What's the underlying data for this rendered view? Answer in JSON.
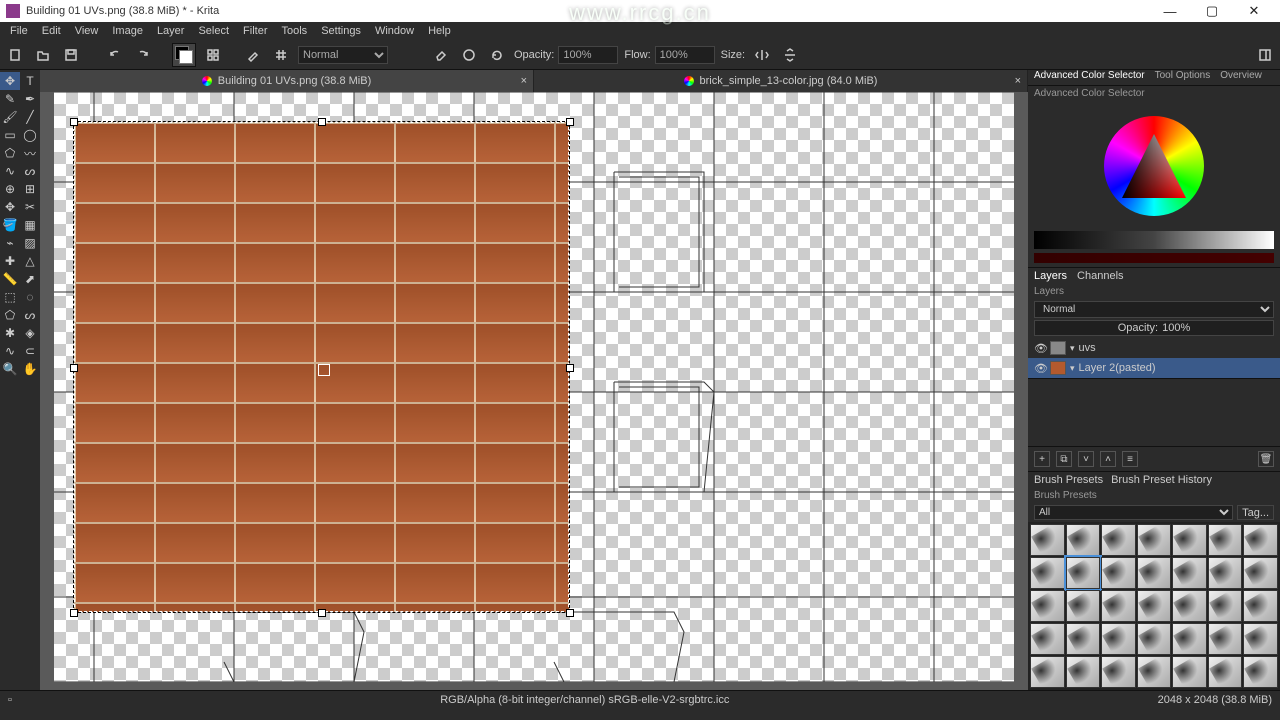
{
  "app": {
    "name": "Krita",
    "title": "Building 01 UVs.png (38.8 MiB) * - Krita"
  },
  "window_buttons": {
    "min": "—",
    "max": "▢",
    "close": "✕"
  },
  "menu": [
    "File",
    "Edit",
    "View",
    "Image",
    "Layer",
    "Select",
    "Filter",
    "Tools",
    "Settings",
    "Window",
    "Help"
  ],
  "toolbar": {
    "brush_preset": "Normal",
    "opacity_label": "Opacity:",
    "opacity_value": "100%",
    "flow_label": "Flow:",
    "flow_value": "100%",
    "size_label": "Size:"
  },
  "tabs": [
    {
      "label": "Building 01 UVs.png (38.8 MiB)",
      "active": true
    },
    {
      "label": "brick_simple_13-color.jpg (84.0 MiB)",
      "active": false
    }
  ],
  "right_tabs": [
    "Advanced Color Selector",
    "Tool Options",
    "Overview"
  ],
  "right_tab_active": "Advanced Color Selector",
  "color_panel_title": "Advanced Color Selector",
  "layers_tabs": [
    "Layers",
    "Channels"
  ],
  "layers_tab_active": "Layers",
  "layers": {
    "title": "Layers",
    "blend_mode": "Normal",
    "opacity_label": "Opacity:",
    "opacity_value": "100%",
    "items": [
      {
        "name": "uvs",
        "selected": false
      },
      {
        "name": "Layer 2(pasted)",
        "selected": true
      }
    ]
  },
  "layer_buttons": [
    "+",
    "⧉",
    "˅",
    "˄",
    "≡"
  ],
  "brush_tabs": [
    "Brush Presets",
    "Brush Preset History"
  ],
  "brush_tab_active": "Brush Presets",
  "brush_panel_title": "Brush Presets",
  "brush_filter": "All",
  "brush_tag": "Tag...",
  "brush_selected_index": 8,
  "statusbar": {
    "mode": "RGB/Alpha (8-bit integer/channel)  sRGB-elle-V2-srgbtrc.icc",
    "dims": "2048 x 2048 (38.8 MiB)"
  },
  "watermark": "www.rrcg.cn",
  "colors": {
    "accent": "#3a5a8a",
    "panel": "#2b2b2b",
    "brick": "#b35a2e"
  }
}
